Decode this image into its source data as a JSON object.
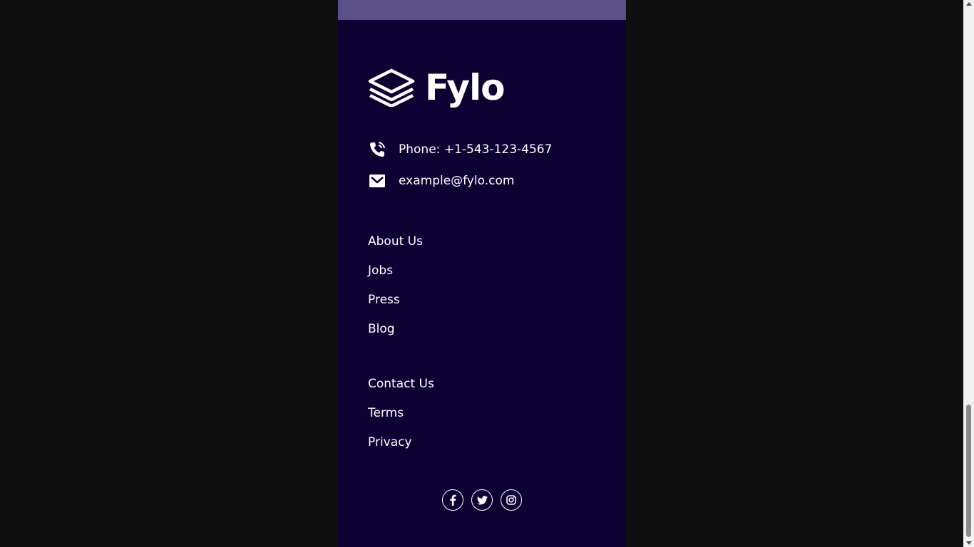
{
  "brand": {
    "name": "Fylo",
    "logo_icon": "stacked-layers-icon"
  },
  "contact": {
    "phone": "Phone: +1-543-123-4567",
    "phone_icon": "phone-icon",
    "email": "example@fylo.com",
    "email_icon": "email-icon"
  },
  "links_primary": [
    "About Us",
    "Jobs",
    "Press",
    "Blog"
  ],
  "links_secondary": [
    "Contact Us",
    "Terms",
    "Privacy"
  ],
  "socials": [
    {
      "name": "facebook-icon"
    },
    {
      "name": "twitter-icon"
    },
    {
      "name": "instagram-icon"
    }
  ],
  "colors": {
    "footer_bg": "#0d0032",
    "strip_bg": "#5b4f8a",
    "text": "#ffffff",
    "outer_bg": "#0f0f10"
  }
}
